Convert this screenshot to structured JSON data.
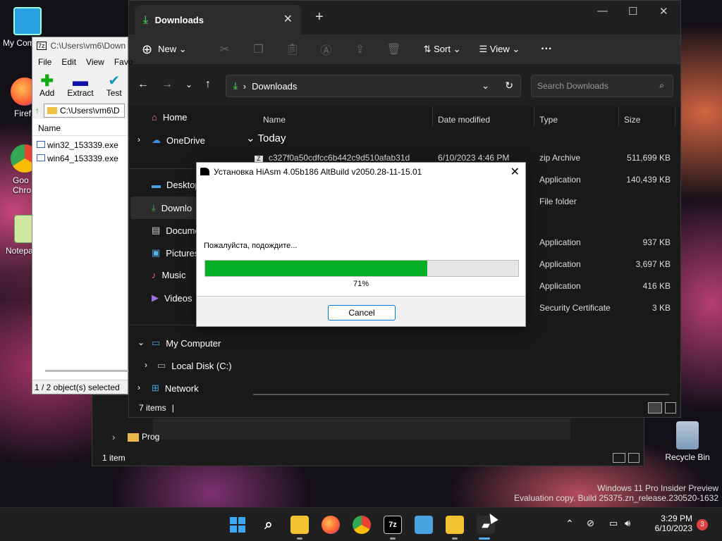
{
  "desktop": {
    "icons": [
      {
        "label": "My Com"
      },
      {
        "label": "Firef"
      },
      {
        "label": "Goo Chro"
      },
      {
        "label": "Notepa"
      },
      {
        "label": "Recycle Bin"
      }
    ],
    "watermark_line1": "Windows 11 Pro Insider Preview",
    "watermark_line2": "Evaluation copy. Build 25375.zn_release.230520-1632"
  },
  "sevenzip": {
    "title": "C:\\Users\\vm6\\Down",
    "menu": [
      "File",
      "Edit",
      "View",
      "Favo"
    ],
    "tools": [
      "Add",
      "Extract",
      "Test"
    ],
    "path": "C:\\Users\\vm6\\D",
    "column_name": "Name",
    "files": [
      "win32_153339.exe",
      "win64_153339.exe"
    ],
    "status": "1 / 2 object(s) selected"
  },
  "explorer": {
    "tab_title": "Downloads",
    "toolbar": {
      "new": "New",
      "sort": "Sort",
      "view": "View"
    },
    "address": "Downloads",
    "search_placeholder": "Search Downloads",
    "nav": {
      "home": "Home",
      "onedrive": "OneDrive",
      "desktop": "Desktop",
      "downloads": "Downlo",
      "documents": "Docume",
      "pictures": "Pictures",
      "music": "Music",
      "videos": "Videos",
      "mycomputer": "My Computer",
      "localdisk": "Local Disk (C:)",
      "network": "Network"
    },
    "columns": [
      "Name",
      "Date modified",
      "Type",
      "Size"
    ],
    "group": "Today",
    "rows": [
      {
        "name": "c327f0a50cdfcc6b442c9d510afab31d",
        "date": "6/10/2023 4:46 PM",
        "type": "zip Archive",
        "size": "511,699 KB"
      },
      {
        "name": "",
        "date": "",
        "type": "Application",
        "size": "140,439 KB"
      },
      {
        "name": "",
        "date": "",
        "type": "File folder",
        "size": ""
      },
      {
        "name": "",
        "date": "",
        "type": "Application",
        "size": "937 KB"
      },
      {
        "name": "",
        "date": "",
        "type": "Application",
        "size": "3,697 KB"
      },
      {
        "name": "",
        "date": "",
        "type": "Application",
        "size": "416 KB"
      },
      {
        "name": "",
        "date": "",
        "type": "Security Certificate",
        "size": "3 KB"
      }
    ],
    "status": "7 items"
  },
  "back_explorer": {
    "folder": "Prog",
    "status": "1 item"
  },
  "dialog": {
    "title": "Установка HiAsm 4.05b186 AltBuild v2050.28-11-15.01",
    "message": "Пожалуйста, подождите...",
    "progress_label": "71%",
    "progress_fraction": 0.71,
    "cancel": "Cancel"
  },
  "taskbar": {
    "time": "3:29 PM",
    "date": "6/10/2023",
    "notification_count": "3"
  },
  "colors": {
    "progress": "#06b025",
    "accent": "#0078d4"
  }
}
